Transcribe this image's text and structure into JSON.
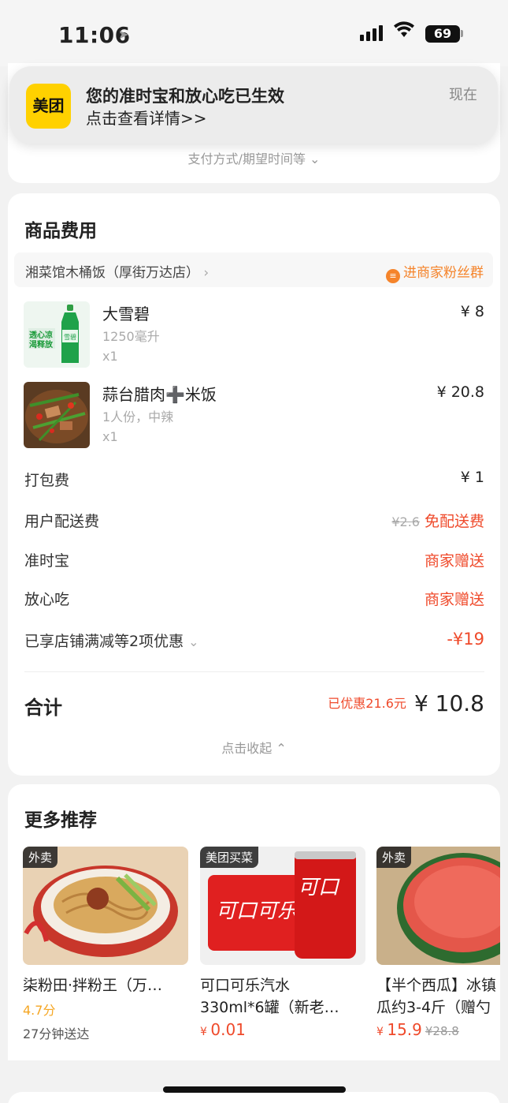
{
  "status_bar": {
    "time": "11:06",
    "battery": "69"
  },
  "notification": {
    "app_logo": "美团",
    "title": "您的准时宝和放心吃已生效",
    "body": "点击查看详情>>",
    "time": "现在"
  },
  "top_card": {
    "pay_options_label": "支付方式/期望时间等"
  },
  "fees": {
    "section_title": "商品费用",
    "store_name": "湘菜馆木桶饭（厚街万达店）",
    "fans_group_label": "进商家粉丝群",
    "items": [
      {
        "name": "大雪碧",
        "spec": "1250毫升",
        "qty": "x1",
        "price": "¥ 8"
      },
      {
        "name": "蒜台腊肉➕米饭",
        "spec": "1人份，中辣",
        "qty": "x1",
        "price": "¥ 20.8"
      }
    ],
    "packing": {
      "label": "打包费",
      "value": "¥ 1"
    },
    "delivery": {
      "label": "用户配送费",
      "original": "¥2.6",
      "value": "免配送费"
    },
    "ontime": {
      "label": "准时宝",
      "value": "商家赠送"
    },
    "safe": {
      "label": "放心吃",
      "value": "商家赠送"
    },
    "discount": {
      "label": "已享店铺满减等2项优惠",
      "value": "-¥19"
    },
    "total": {
      "label": "合计",
      "saved": "已优惠21.6元",
      "value": "¥ 10.8"
    },
    "collapse_label": "点击收起"
  },
  "recommend": {
    "section_title": "更多推荐",
    "items": [
      {
        "tag": "外卖",
        "name": "柒粉田·拌粉王（万…",
        "rating": "4.7分",
        "eta": "27分钟送达"
      },
      {
        "tag": "美团买菜",
        "name_line1": "可口可乐汽水",
        "name_line2": "330ml*6罐（新老…",
        "price": "0.01"
      },
      {
        "tag": "外卖",
        "name_line1": "【半个西瓜】冰镇",
        "name_line2": "瓜约3-4斤（赠勺",
        "price": "15.9",
        "old_price": "¥28.8"
      }
    ]
  },
  "colors": {
    "accent_red": "#ef4a2b",
    "accent_orange": "#f5842b",
    "brand_yellow": "#ffd100"
  }
}
